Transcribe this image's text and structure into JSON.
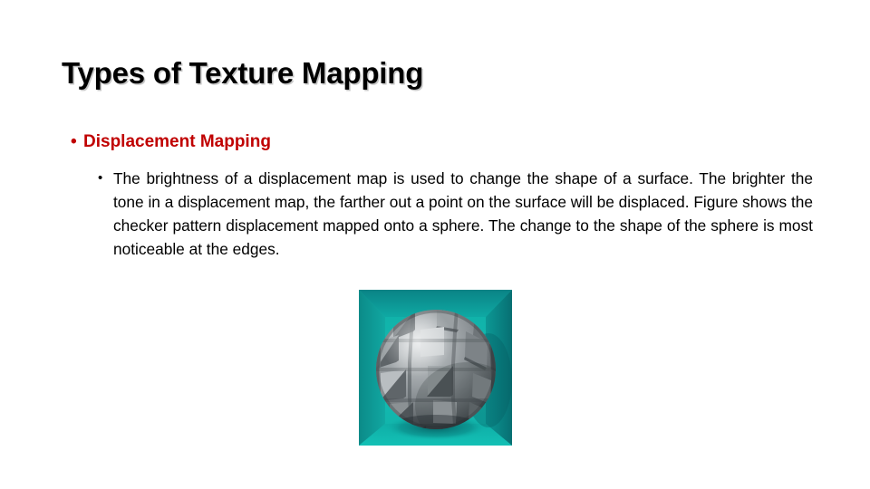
{
  "slide": {
    "title": "Types of Texture Mapping",
    "background_color": "#FFFFFF",
    "title_color": "#000000"
  },
  "bullets": {
    "level1": {
      "marker": "•",
      "label": "Displacement Mapping",
      "color": "#C00000"
    },
    "level2": {
      "marker": "•",
      "color": "#000000",
      "text": "The brightness of a displacement map is used to change the shape of a surface. The brighter the tone in a displacement map, the farther out a point on the surface will be displaced. Figure shows the checker pattern displacement mapped onto a sphere. The change to the shape of the sphere is most noticeable at the edges."
    }
  },
  "figure": {
    "name": "displacement-mapped-sphere-render",
    "description": "Checker pattern displacement mapped onto a grey sphere inside an open teal box",
    "box_colors": {
      "back_wall": "#12B9B0",
      "ceiling": "#0C8F8C",
      "left_wall": "#0E9A96",
      "right_wall": "#0B7E7E",
      "floor": "#12BDB3"
    },
    "sphere_colors": {
      "base": "#8E9397",
      "light": "#C6CACC",
      "dark": "#4E5255",
      "shadow": "#2C3133"
    }
  }
}
